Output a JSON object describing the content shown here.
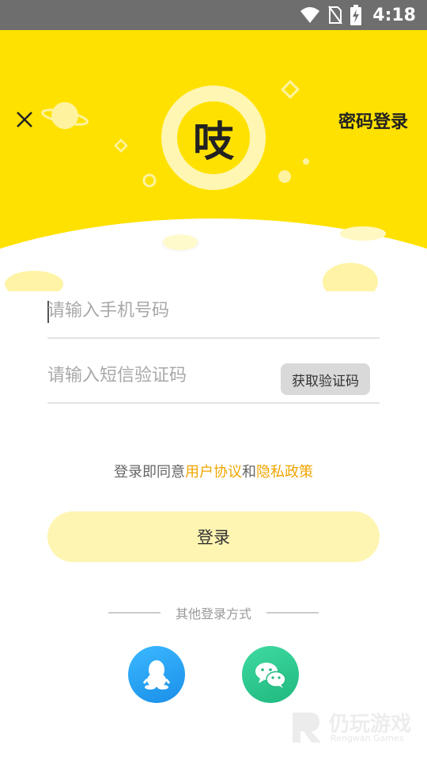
{
  "status_bar": {
    "time": "4:18"
  },
  "header": {
    "password_login_label": "密码登录"
  },
  "logo": {
    "glyph": "吱"
  },
  "phone_field": {
    "placeholder": "请输入手机号码"
  },
  "code_field": {
    "placeholder": "请输入短信验证码",
    "get_code_label": "获取验证码"
  },
  "agreement": {
    "prefix": "登录即同意",
    "user_agreement": "用户协议",
    "conjunction": "和",
    "privacy_policy": "隐私政策"
  },
  "login_button_label": "登录",
  "other_login": {
    "title": "其他登录方式"
  },
  "social_icons": [
    "qq-icon",
    "wechat-icon"
  ],
  "watermark": {
    "name": "仍玩游戏",
    "sub": "Rengwan Games"
  },
  "colors": {
    "hero_yellow": "#ffe100",
    "link_orange": "#f0a500",
    "login_button_bg": "#fff5b3"
  }
}
